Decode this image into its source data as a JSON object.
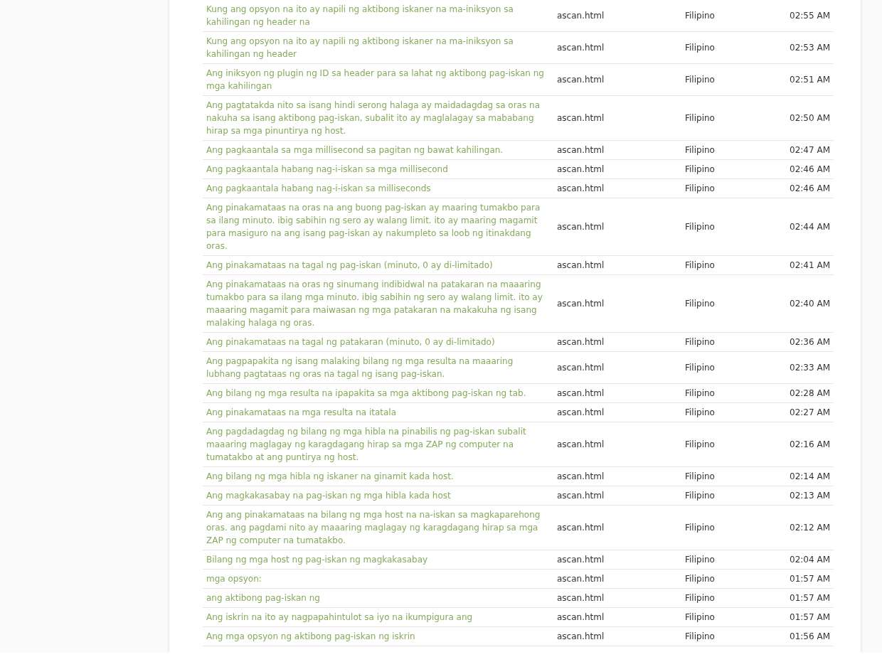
{
  "table": {
    "rows": [
      {
        "text": "Kung ang opsyon na ito ay napili ng aktibong iskaner na ma-iniksyon sa kahilingan ng header na",
        "file": "ascan.html",
        "language": "Filipino",
        "time": "02:55 AM"
      },
      {
        "text": "Kung ang opsyon na ito ay napili ng aktibong iskaner na ma-iniksyon sa kahilingan ng header",
        "file": "ascan.html",
        "language": "Filipino",
        "time": "02:53 AM"
      },
      {
        "text": "Ang iniksyon ng plugin ng ID sa header para sa lahat ng aktibong pag-iskan ng mga kahilingan",
        "file": "ascan.html",
        "language": "Filipino",
        "time": "02:51 AM"
      },
      {
        "text": "Ang pagtatakda nito sa isang hindi serong halaga ay maidadagdag sa oras na nakuha sa isang aktibong pag-iskan, subalit ito ay maglalagay sa mababang hirap sa mga pinuntirya ng host.",
        "file": "ascan.html",
        "language": "Filipino",
        "time": "02:50 AM"
      },
      {
        "text": "Ang pagkaantala sa mga millisecond sa pagitan ng bawat kahilingan.",
        "file": "ascan.html",
        "language": "Filipino",
        "time": "02:47 AM"
      },
      {
        "text": "Ang pagkaantala habang nag-i-iskan sa mga millisecond",
        "file": "ascan.html",
        "language": "Filipino",
        "time": "02:46 AM"
      },
      {
        "text": "Ang pagkaantala habang nag-i-iskan sa milliseconds",
        "file": "ascan.html",
        "language": "Filipino",
        "time": "02:46 AM"
      },
      {
        "text": "Ang pinakamataas na oras na ang buong pag-iskan ay maaring tumakbo para sa ilang minuto. ibig sabihin ng sero ay walang limit. ito ay maaring magamit para masiguro na ang isang pag-iskan ay nakumpleto sa loob ng itinakdang oras.",
        "file": "ascan.html",
        "language": "Filipino",
        "time": "02:44 AM"
      },
      {
        "text": "Ang pinakamataas na tagal ng pag-iskan (minuto, 0 ay di-limitado)",
        "file": "ascan.html",
        "language": "Filipino",
        "time": "02:41 AM"
      },
      {
        "text": "Ang pinakamataas na oras ng sinumang indibidwal na patakaran na maaaring tumakbo para sa ilang mga minuto. ibig sabihin ng sero ay walang limit. ito ay maaaring magamit para maiwasan ng mga patakaran na makakuha ng isang malaking halaga ng oras.",
        "file": "ascan.html",
        "language": "Filipino",
        "time": "02:40 AM"
      },
      {
        "text": "Ang pinakamataas na tagal ng patakaran (minuto, 0 ay di-limitado)",
        "file": "ascan.html",
        "language": "Filipino",
        "time": "02:36 AM"
      },
      {
        "text": "Ang pagpapakita ng isang malaking bilang ng mga resulta na maaaring lubhang pagtataas ng oras na tagal ng isang pag-iskan.",
        "file": "ascan.html",
        "language": "Filipino",
        "time": "02:33 AM"
      },
      {
        "text": "Ang bilang ng mga resulta na ipapakita sa mga aktibong pag-iskan ng tab.",
        "file": "ascan.html",
        "language": "Filipino",
        "time": "02:28 AM"
      },
      {
        "text": "Ang pinakamataas na mga resulta na itatala",
        "file": "ascan.html",
        "language": "Filipino",
        "time": "02:27 AM"
      },
      {
        "text": "Ang pagdadagdag ng bilang ng mga hibla na pinabilis ng pag-iskan subalit maaaring maglagay ng karagdagang hirap sa mga ZAP ng computer na tumatakbo at ang puntirya ng host.",
        "file": "ascan.html",
        "language": "Filipino",
        "time": "02:16 AM"
      },
      {
        "text": "Ang bilang ng mga hibla ng iskaner na ginamit kada host.",
        "file": "ascan.html",
        "language": "Filipino",
        "time": "02:14 AM"
      },
      {
        "text": "Ang magkakasabay na pag-iskan ng mga hibla kada host",
        "file": "ascan.html",
        "language": "Filipino",
        "time": "02:13 AM"
      },
      {
        "text": "Ang ang pinakamataas na bilang ng mga host na na-iskan sa magkaparehong oras. ang pagdami nito ay maaaring maglagay ng karagdagang hirap sa mga ZAP ng computer na tumatakbo.",
        "file": "ascan.html",
        "language": "Filipino",
        "time": "02:12 AM"
      },
      {
        "text": "Bilang ng mga host ng pag-iskan ng magkakasabay",
        "file": "ascan.html",
        "language": "Filipino",
        "time": "02:04 AM"
      },
      {
        "text": "mga opsyon:",
        "file": "ascan.html",
        "language": "Filipino",
        "time": "01:57 AM"
      },
      {
        "text": "ang aktibong pag-iskan ng",
        "file": "ascan.html",
        "language": "Filipino",
        "time": "01:57 AM"
      },
      {
        "text": "Ang iskrin na ito ay nagpapahintulot sa iyo na ikumpigura ang",
        "file": "ascan.html",
        "language": "Filipino",
        "time": "01:57 AM"
      },
      {
        "text": "Ang mga opsyon ng aktibong pag-iskan ng iskrin",
        "file": "ascan.html",
        "language": "Filipino",
        "time": "01:56 AM"
      }
    ]
  }
}
